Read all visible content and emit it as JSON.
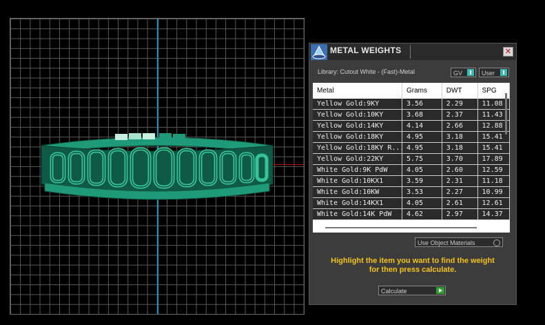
{
  "panel": {
    "title": "METAL WEIGHTS",
    "close_glyph": "✕",
    "library_label": "Library: Cutout White - (Fast)-Metal",
    "toggles": [
      {
        "label": "GV"
      },
      {
        "label": "User"
      }
    ],
    "table": {
      "columns": [
        "Metal",
        "Grams",
        "DWT",
        "SPG"
      ],
      "rows": [
        [
          "Yellow Gold:9KY",
          "3.56",
          "2.29",
          "11.08"
        ],
        [
          "Yellow Gold:10KY",
          "3.68",
          "2.37",
          "11.43"
        ],
        [
          "Yellow Gold:14KY",
          "4.14",
          "2.66",
          "12.88"
        ],
        [
          "Yellow Gold:18KY",
          "4.95",
          "3.18",
          "15.41"
        ],
        [
          "Yellow Gold:18KY R...",
          "4.95",
          "3.18",
          "15.41"
        ],
        [
          "Yellow Gold:22KY",
          "5.75",
          "3.70",
          "17.89"
        ],
        [
          "White Gold:9K PdW",
          "4.05",
          "2.60",
          "12.59"
        ],
        [
          "White Gold:10KX1",
          "3.59",
          "2.31",
          "11.18"
        ],
        [
          "White Gold:10KW",
          "3.53",
          "2.27",
          "10.99"
        ],
        [
          "White Gold:14KX1",
          "4.05",
          "2.61",
          "12.61"
        ],
        [
          "White Gold:14K PdW",
          "4.62",
          "2.97",
          "14.37"
        ]
      ]
    },
    "use_object_materials": "Use Object Materials",
    "hint_line1": "Highlight the item you want to find the weight",
    "hint_line2": "for then press calculate.",
    "calculate_label": "Calculate"
  },
  "colors": {
    "hint": "#f3c21a",
    "ring": "#1f9a78",
    "axis_vertical": "#1d97c0",
    "axis_horizontal": "#b01010"
  }
}
